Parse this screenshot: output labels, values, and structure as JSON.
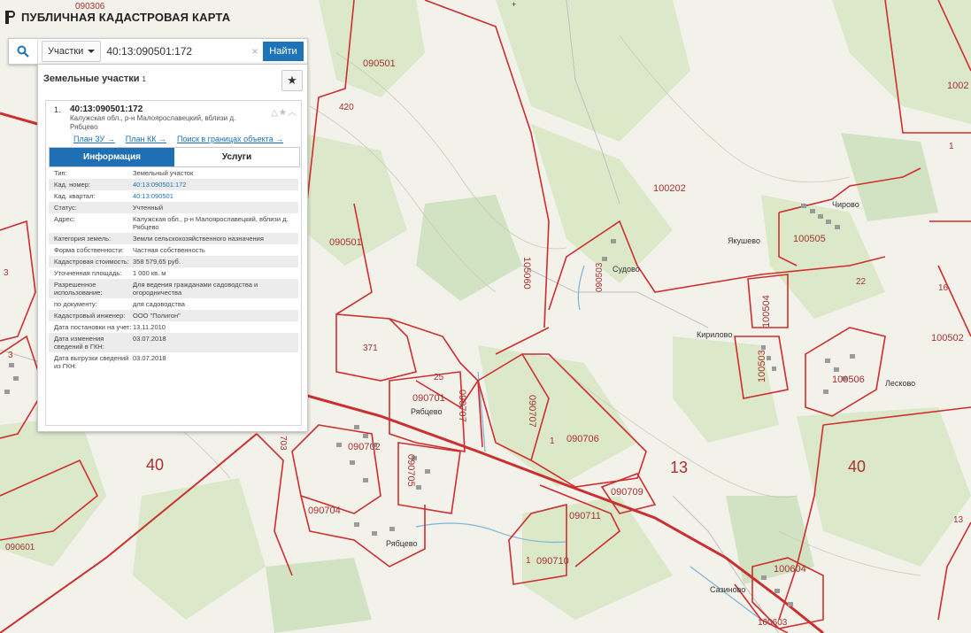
{
  "app": {
    "title": "ПУБЛИЧНАЯ КАДАСТРОВАЯ КАРТА"
  },
  "search": {
    "type_label": "Участки",
    "value": "40:13:090501:172",
    "button": "Найти"
  },
  "panel": {
    "heading": "Земельные участки",
    "count": "1",
    "item": {
      "index": "1.",
      "number": "40:13:090501:172",
      "address": "Калужская обл., р-н Малоярославецкий, вблизи д. Рябцево",
      "links": [
        "План ЗУ →",
        "План КК →",
        "Поиск в границах объекта →"
      ],
      "tabs": [
        "Информация",
        "Услуги"
      ],
      "rows": [
        {
          "k": "Тип:",
          "v": "Земельный участок"
        },
        {
          "k": "Кад. номер:",
          "v": "40:13:090501:172"
        },
        {
          "k": "Кад. квартал:",
          "v": "40:13:090501"
        },
        {
          "k": "Статус:",
          "v": "Учтенный"
        },
        {
          "k": "Адрес:",
          "v": "Калужская обл., р-н Малоярославецкий, вблизи д. Рябцево"
        },
        {
          "k": "Категория земель:",
          "v": "Земли сельскохозяйственного назначения"
        },
        {
          "k": "Форма собственности:",
          "v": "Частная собственность"
        },
        {
          "k": "Кадастровая стоимость:",
          "v": "358 579,65 руб."
        },
        {
          "k": "Уточненная площадь:",
          "v": "1 000 кв. м"
        },
        {
          "k": "Разрешенное использование:",
          "v": "Для ведения гражданами садоводства и огородничества"
        },
        {
          "k": "по документу:",
          "v": "для садоводства"
        },
        {
          "k": "Кадастровый инженер:",
          "v": "ООО \"Полигон\""
        },
        {
          "k": "Дата постановки на учет:",
          "v": "13.11.2010"
        },
        {
          "k": "Дата изменения сведений в ГКН:",
          "v": "03.07.2018"
        },
        {
          "k": "Дата выгрузки сведений из ГКН:",
          "v": "03.07.2018"
        }
      ]
    }
  },
  "map": {
    "labels": [
      "090306",
      "090501",
      "090501",
      "100202",
      "100505",
      "100504",
      "100502",
      "100506",
      "100503",
      "090701",
      "090702",
      "090704",
      "090705",
      "090707",
      "090707",
      "090706",
      "090709",
      "090711",
      "090710",
      "090601",
      "100604",
      "100603",
      "105060",
      "090503",
      "40",
      "40",
      "13",
      "1002",
      "371",
      "25",
      "22",
      "1",
      "1",
      "1",
      "3",
      "3",
      "13",
      "16",
      "420",
      "703"
    ],
    "towns": [
      "Судово",
      "Якушево",
      "Кирилово",
      "Рябцево",
      "Рябцево",
      "Сазиново",
      "Лесково",
      "Чирово"
    ],
    "top_mark": "+"
  }
}
